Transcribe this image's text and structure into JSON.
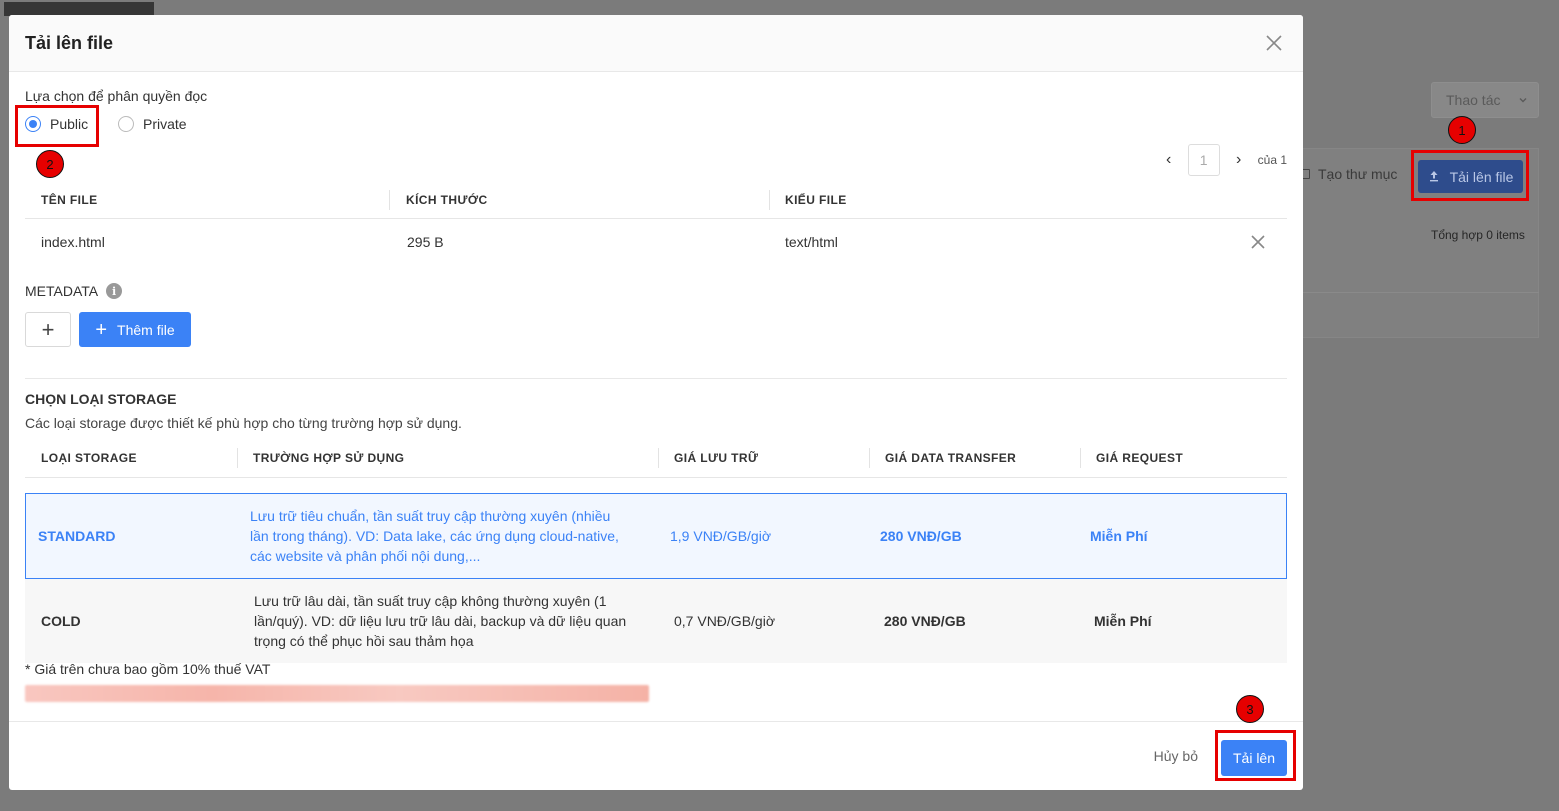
{
  "background": {
    "actions_label": "Thao tác",
    "create_folder_label": "Tạo thư mục",
    "upload_file_label": "Tải lên file",
    "total_text": "Tổng hợp 0 items"
  },
  "annotations": [
    "1",
    "2",
    "3"
  ],
  "modal": {
    "title": "Tải lên file",
    "permission_label": "Lựa chọn để phân quyền đọc",
    "permission_options": [
      {
        "label": "Public",
        "checked": true
      },
      {
        "label": "Private",
        "checked": false
      }
    ],
    "pagination": {
      "current": "1",
      "of_text": "của 1"
    },
    "file_table": {
      "headers": [
        "TÊN FILE",
        "KÍCH THƯỚC",
        "KIỂU FILE"
      ],
      "rows": [
        {
          "name": "index.html",
          "size": "295 B",
          "type": "text/html"
        }
      ]
    },
    "metadata_label": "METADATA",
    "add_file_label": "Thêm file",
    "storage": {
      "title": "CHỌN LOẠI STORAGE",
      "description": "Các loại storage được thiết kế phù hợp cho từng trường hợp sử dụng.",
      "headers": [
        "LOẠI STORAGE",
        "TRƯỜNG HỢP SỬ DỤNG",
        "GIÁ LƯU TRỮ",
        "GIÁ DATA TRANSFER",
        "GIÁ REQUEST"
      ],
      "rows": [
        {
          "type": "STANDARD",
          "use_case": "Lưu trữ tiêu chuẩn, tần suất truy cập thường xuyên (nhiều lần trong tháng). VD: Data lake, các ứng dụng cloud-native, các website và phân phối nội dung,...",
          "storage_price": "1,9 VNĐ/GB/giờ",
          "transfer_price": "280 VNĐ/GB",
          "request_price": "Miễn Phí",
          "selected": true
        },
        {
          "type": "COLD",
          "use_case": "Lưu trữ lâu dài, tần suất truy cập không thường xuyên (1 lần/quý). VD: dữ liệu lưu trữ lâu dài, backup và dữ liệu quan trọng có thể phục hồi sau thảm họa",
          "storage_price": "0,7 VNĐ/GB/giờ",
          "transfer_price": "280 VNĐ/GB",
          "request_price": "Miễn Phí",
          "selected": false
        }
      ],
      "vat_note": "* Giá trên chưa bao gồm 10% thuế VAT"
    },
    "footer": {
      "cancel_label": "Hủy bỏ",
      "upload_label": "Tải lên"
    }
  },
  "colors": {
    "primary": "#3b82f6",
    "annotation": "#e60000"
  }
}
